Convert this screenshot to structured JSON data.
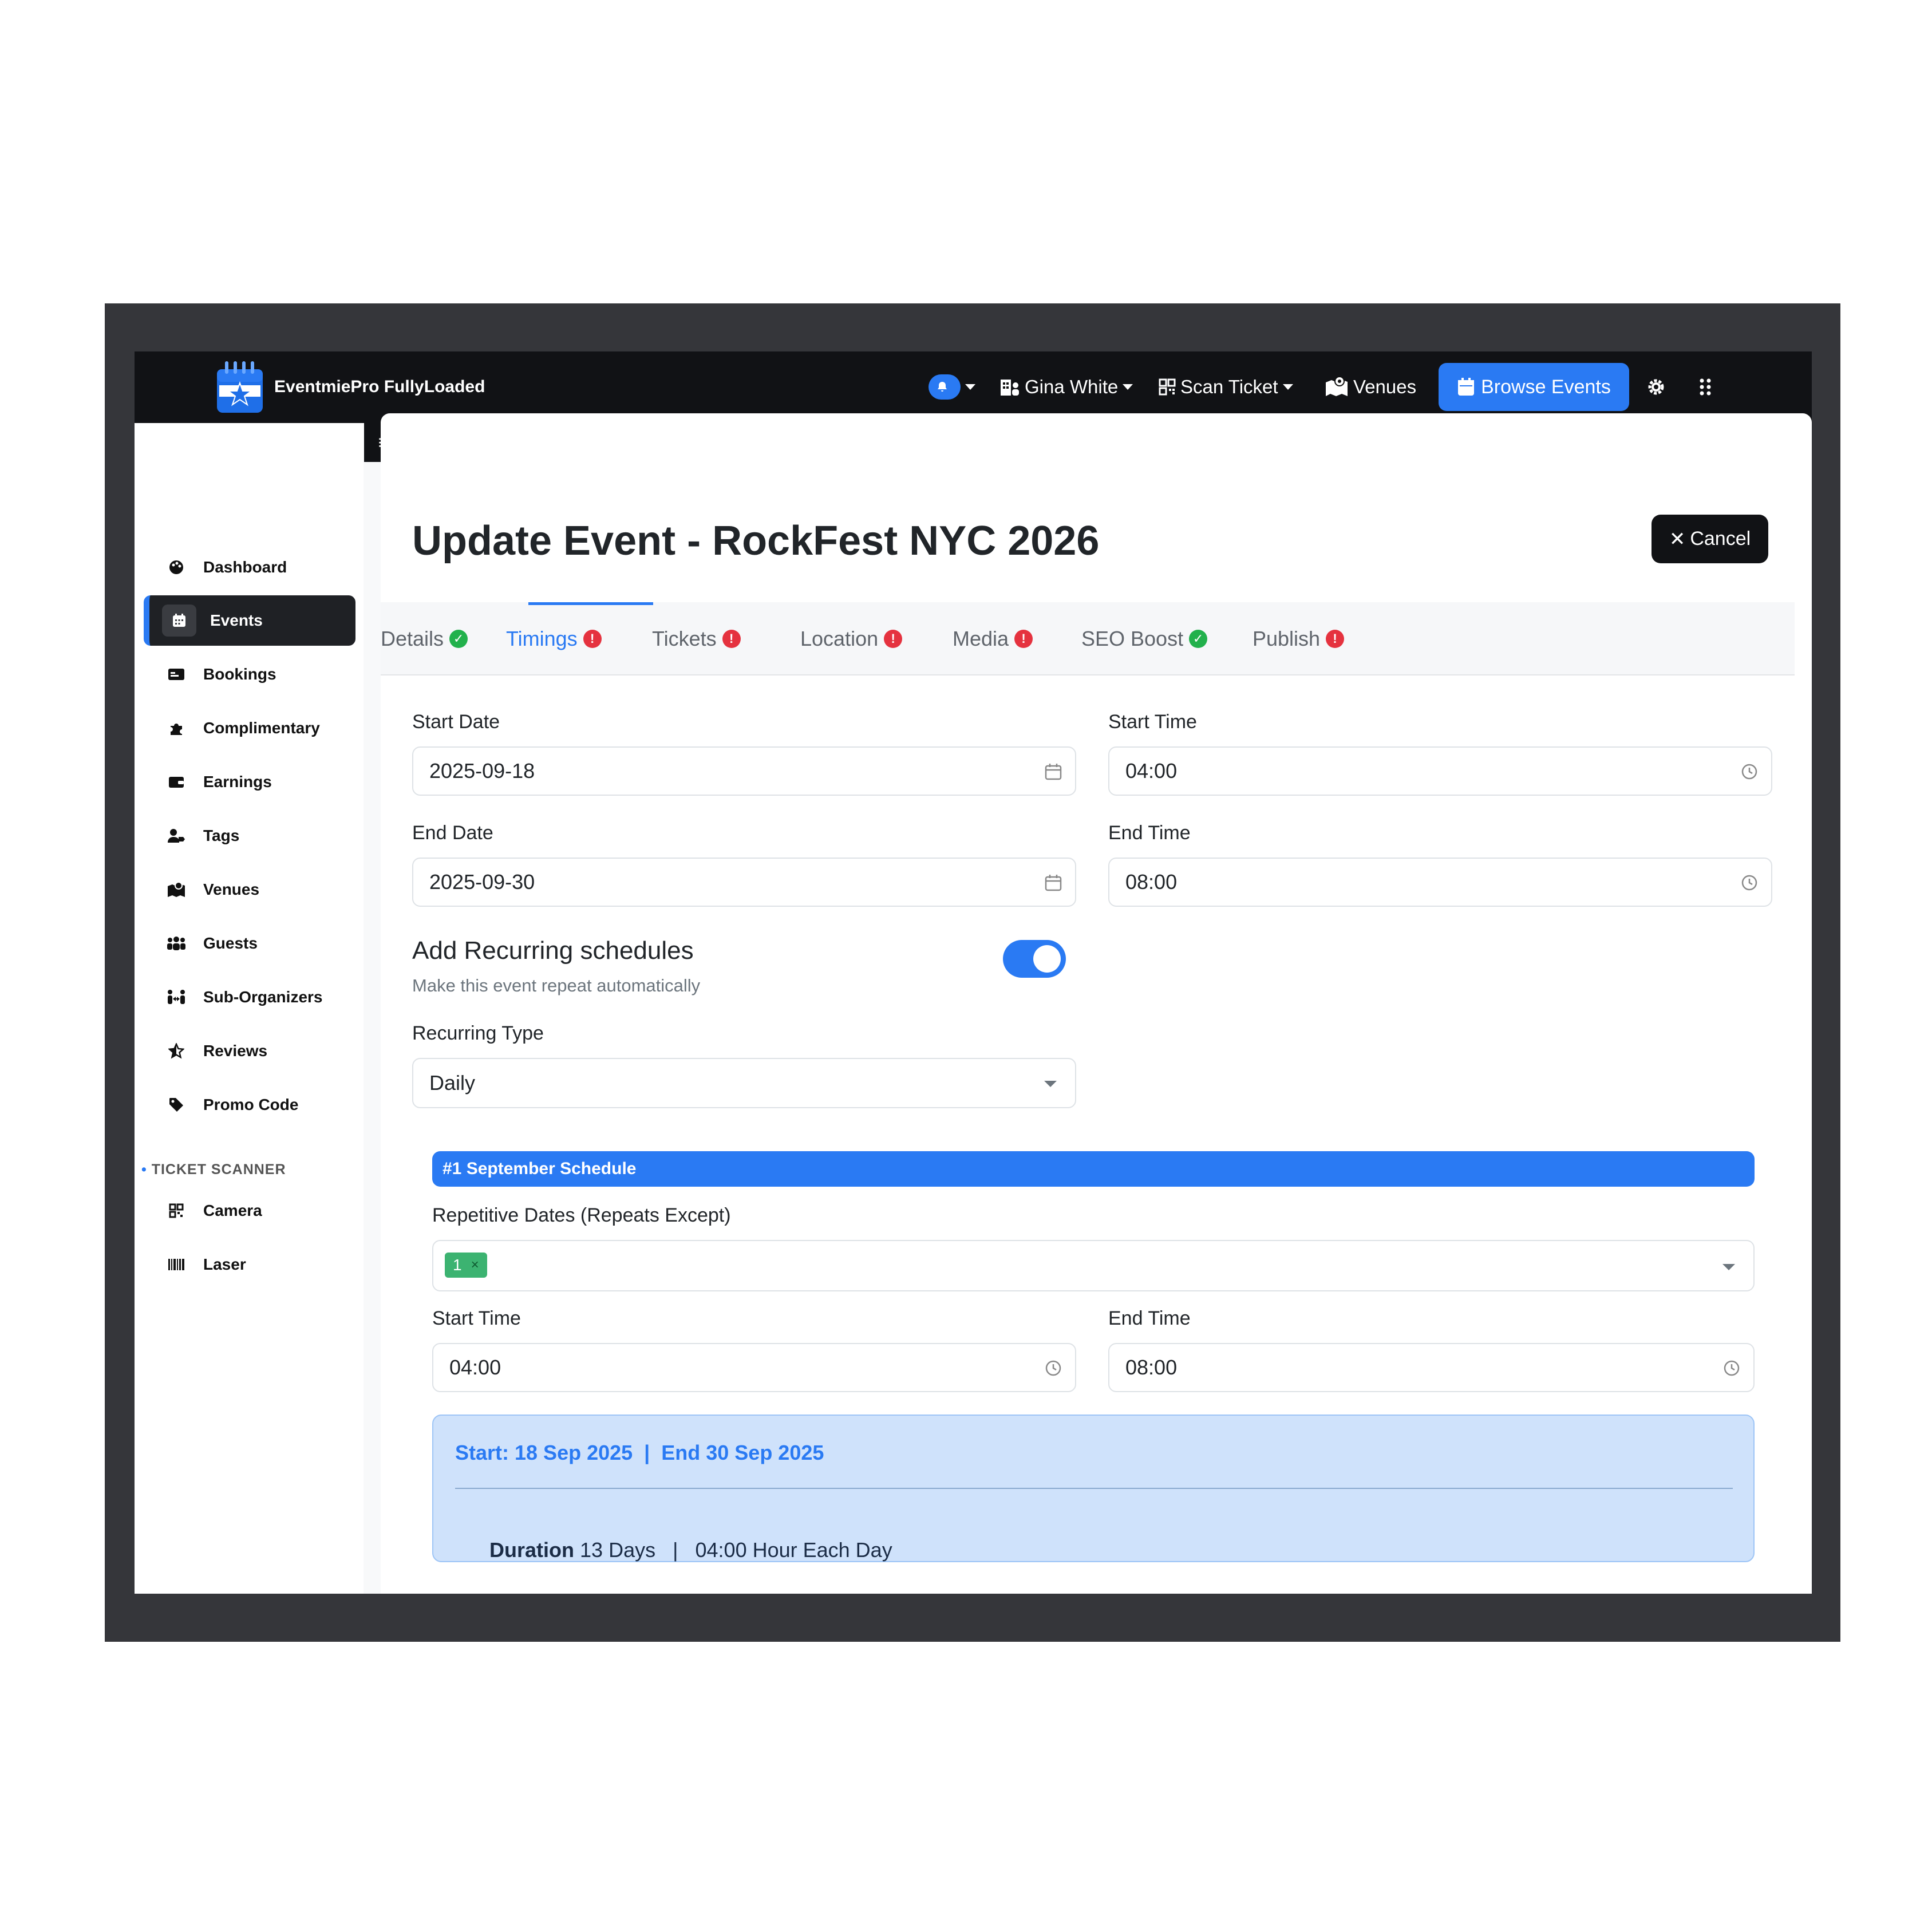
{
  "brand": {
    "name": "EventmiePro FullyLoaded"
  },
  "topnav": {
    "user_name": "Gina White",
    "scan_ticket": "Scan Ticket",
    "venues": "Venues",
    "browse_events": "Browse Events"
  },
  "sidebar": {
    "items": [
      {
        "label": "Dashboard",
        "icon": "palette-icon"
      },
      {
        "label": "Events",
        "icon": "calendar-icon",
        "active": true
      },
      {
        "label": "Bookings",
        "icon": "id-card-icon"
      },
      {
        "label": "Complimentary",
        "icon": "puzzle-icon"
      },
      {
        "label": "Earnings",
        "icon": "wallet-icon"
      },
      {
        "label": "Tags",
        "icon": "user-tag-icon"
      },
      {
        "label": "Venues",
        "icon": "map-location-icon"
      },
      {
        "label": "Guests",
        "icon": "people-group-icon"
      },
      {
        "label": "Sub-Organizers",
        "icon": "people-arrows-icon"
      },
      {
        "label": "Reviews",
        "icon": "star-half-icon"
      },
      {
        "label": "Promo Code",
        "icon": "tag-icon"
      }
    ],
    "section_title": "TICKET SCANNER",
    "scanner_items": [
      {
        "label": "Camera",
        "icon": "qrcode-icon"
      },
      {
        "label": "Laser",
        "icon": "barcode-icon"
      }
    ]
  },
  "page": {
    "title": "Update Event - RockFest NYC 2026",
    "cancel_label": "Cancel"
  },
  "tabs": [
    {
      "label": "Details",
      "status": "ok"
    },
    {
      "label": "Timings",
      "status": "error",
      "active": true
    },
    {
      "label": "Tickets",
      "status": "error"
    },
    {
      "label": "Location",
      "status": "error"
    },
    {
      "label": "Media",
      "status": "error"
    },
    {
      "label": "SEO Boost",
      "status": "ok"
    },
    {
      "label": "Publish",
      "status": "error"
    }
  ],
  "form": {
    "start_date_label": "Start Date",
    "start_date": "2025-09-18",
    "start_time_label": "Start Time",
    "start_time": "04:00",
    "end_date_label": "End Date",
    "end_date": "2025-09-30",
    "end_time_label": "End Time",
    "end_time": "08:00",
    "recurring_title": "Add Recurring schedules",
    "recurring_subtitle": "Make this event repeat automatically",
    "recurring_enabled": true,
    "recurring_type_label": "Recurring Type",
    "recurring_type": "Daily"
  },
  "schedule": {
    "header": "#1  September Schedule",
    "repetitive_label": "Repetitive Dates (Repeats Except)",
    "chip_value": "1",
    "chip_remove": "×",
    "start_time_label": "Start Time",
    "start_time": "04:00",
    "end_time_label": "End Time",
    "end_time": "08:00"
  },
  "summary": {
    "range": "Start: 18 Sep 2025  |  End 30 Sep 2025",
    "duration_label": "Duration",
    "duration_value": "13 Days",
    "separator": "|",
    "hours": "04:00 Hour Each Day"
  },
  "colors": {
    "accent": "#2a7af3",
    "nav_bg": "#111215",
    "ok": "#22b14c",
    "error": "#e5323f",
    "chip": "#3cb371",
    "summary_bg": "#cfe2fb"
  }
}
